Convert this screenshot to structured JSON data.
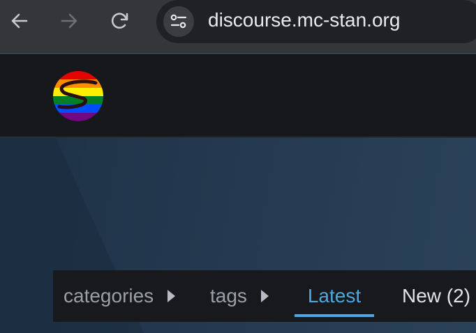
{
  "browser": {
    "url": "discourse.mc-stan.org",
    "icons": [
      "back-arrow-icon",
      "forward-arrow-icon",
      "reload-icon",
      "site-settings-icon"
    ]
  },
  "header": {
    "logo_icon": "stan-rainbow-logo-icon"
  },
  "nav": {
    "categories_label": "categories",
    "tags_label": "tags",
    "latest_label": "Latest",
    "new_label": "New (2)",
    "active_color": "#4fa9e0"
  }
}
